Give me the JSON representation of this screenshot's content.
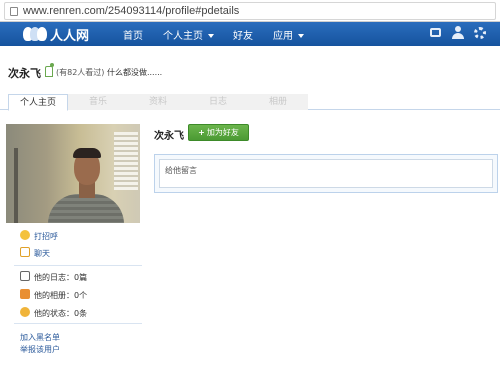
{
  "browser": {
    "url": "www.renren.com/254093114/profile#pdetails"
  },
  "nav": {
    "logo_text": "人人网",
    "items": [
      {
        "label": "首页",
        "has_dropdown": false
      },
      {
        "label": "个人主页",
        "has_dropdown": true
      },
      {
        "label": "好友",
        "has_dropdown": false
      },
      {
        "label": "应用",
        "has_dropdown": true
      }
    ],
    "right_icons": [
      "message-icon",
      "friend-request-icon",
      "settings-icon"
    ]
  },
  "profile": {
    "name": "次永飞",
    "views_text": "(有82人看过)",
    "status_text": "什么都没做......"
  },
  "tabs": [
    {
      "label": "个人主页",
      "active": true
    },
    {
      "label": "音乐",
      "active": false
    },
    {
      "label": "资料",
      "active": false
    },
    {
      "label": "日志",
      "active": false
    },
    {
      "label": "相册",
      "active": false
    }
  ],
  "sidebar": {
    "actions": [
      {
        "label": "打招呼",
        "icon": "greet-icon"
      },
      {
        "label": "聊天",
        "icon": "chat-icon"
      }
    ],
    "stats": [
      {
        "label": "他的日志：0篇",
        "icon": "blog-icon"
      },
      {
        "label": "他的相册：0个",
        "icon": "album-icon"
      },
      {
        "label": "他的状态：0条",
        "icon": "status-icon"
      }
    ],
    "footer_links": [
      {
        "label": "加入黑名单"
      },
      {
        "label": "举报该用户"
      }
    ]
  },
  "main": {
    "name": "次永飞",
    "add_friend_label": "加为好友",
    "message_placeholder": "给他留言"
  },
  "colors": {
    "nav_bg": "#1a5bab",
    "link": "#2b5a9b",
    "add_button": "#5aa83f"
  }
}
